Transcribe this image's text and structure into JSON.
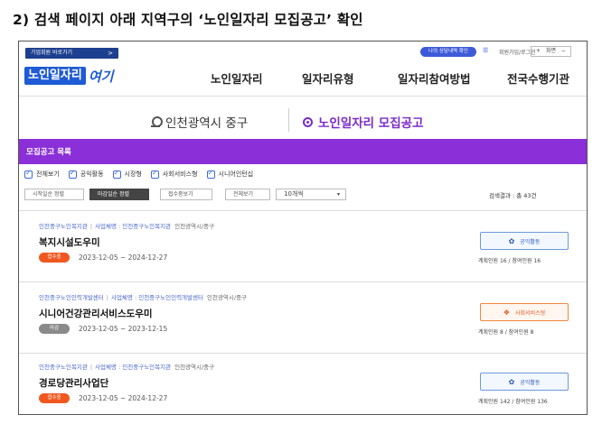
{
  "heading": "2) 검색 페이지 아래 지역구의 ‘노인일자리 모집공고’ 확인",
  "topbar": {
    "quick_label": "기업회원 바로가기",
    "quick_arrow": ">",
    "login_label": "나의 상담내역 확인",
    "util_link": "회원가입/로그인",
    "zoom_plus": "+",
    "zoom_label": "화면",
    "zoom_minus": "−"
  },
  "logo": {
    "part1": "노인일자리",
    "part2": "여기"
  },
  "nav": [
    "노인일자리",
    "일자리유형",
    "일자리참여방법",
    "전국수행기관"
  ],
  "location": "인천광역시 중구",
  "active_tab": "노인일자리 모집공고",
  "band_title": "모집공고 목록",
  "filters": [
    "전체보기",
    "공익활동",
    "시장형",
    "사회서비스형",
    "시니어인턴십"
  ],
  "sort_buttons": [
    "시작일순 정렬",
    "마감일순 정렬",
    "접수중보기",
    "전체보기"
  ],
  "per_page": "10개씩",
  "result_label": "검색결과 : 총 43건",
  "jobs": [
    {
      "org": "인천중구노인복지관",
      "company": "사업체명 : 인천중구노인복지관",
      "region": "인천광역시/중구",
      "title": "복지시설도우미",
      "status": "접수중",
      "dates": "2023-12-05 ~ 2024-12-27",
      "type": "공익활동",
      "counts": "계획인원 16 / 참여인원 16"
    },
    {
      "org": "인천중구노인인력개발센터",
      "company": "사업체명 : 인천중구노인인력개발센터",
      "region": "인천광역시/중구",
      "title": "시니어건강관리서비스도우미",
      "status": "마감",
      "dates": "2023-12-05 ~ 2023-12-15",
      "type": "사회서비스형",
      "counts": "계획인원 8 / 참여인원 8"
    },
    {
      "org": "인천중구노인복지관",
      "company": "사업체명 : 인천중구노인복지관",
      "region": "인천광역시/중구",
      "title": "경로당관리사업단",
      "status": "접수중",
      "dates": "2023-12-05 ~ 2024-12-27",
      "type": "공익활동",
      "counts": "계획인원 142 / 참여인원 136"
    }
  ],
  "colors": {
    "purple": "#8b2fd8",
    "blue": "#1f5bd4",
    "orange": "#f0581f"
  }
}
